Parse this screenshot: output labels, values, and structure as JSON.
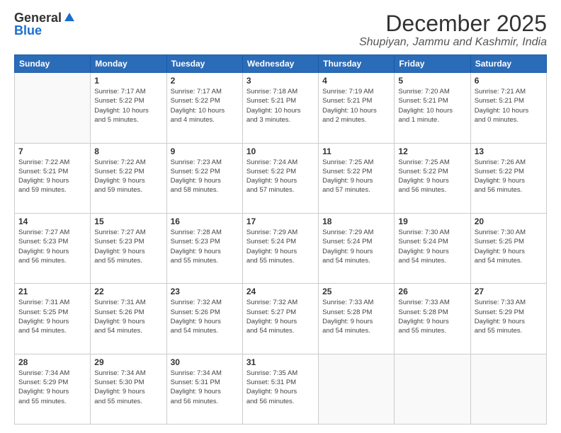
{
  "logo": {
    "general": "General",
    "blue": "Blue"
  },
  "title": "December 2025",
  "location": "Shupiyan, Jammu and Kashmir, India",
  "weekdays": [
    "Sunday",
    "Monday",
    "Tuesday",
    "Wednesday",
    "Thursday",
    "Friday",
    "Saturday"
  ],
  "weeks": [
    [
      {
        "day": "",
        "info": ""
      },
      {
        "day": "1",
        "info": "Sunrise: 7:17 AM\nSunset: 5:22 PM\nDaylight: 10 hours\nand 5 minutes."
      },
      {
        "day": "2",
        "info": "Sunrise: 7:17 AM\nSunset: 5:22 PM\nDaylight: 10 hours\nand 4 minutes."
      },
      {
        "day": "3",
        "info": "Sunrise: 7:18 AM\nSunset: 5:21 PM\nDaylight: 10 hours\nand 3 minutes."
      },
      {
        "day": "4",
        "info": "Sunrise: 7:19 AM\nSunset: 5:21 PM\nDaylight: 10 hours\nand 2 minutes."
      },
      {
        "day": "5",
        "info": "Sunrise: 7:20 AM\nSunset: 5:21 PM\nDaylight: 10 hours\nand 1 minute."
      },
      {
        "day": "6",
        "info": "Sunrise: 7:21 AM\nSunset: 5:21 PM\nDaylight: 10 hours\nand 0 minutes."
      }
    ],
    [
      {
        "day": "7",
        "info": "Sunrise: 7:22 AM\nSunset: 5:21 PM\nDaylight: 9 hours\nand 59 minutes."
      },
      {
        "day": "8",
        "info": "Sunrise: 7:22 AM\nSunset: 5:22 PM\nDaylight: 9 hours\nand 59 minutes."
      },
      {
        "day": "9",
        "info": "Sunrise: 7:23 AM\nSunset: 5:22 PM\nDaylight: 9 hours\nand 58 minutes."
      },
      {
        "day": "10",
        "info": "Sunrise: 7:24 AM\nSunset: 5:22 PM\nDaylight: 9 hours\nand 57 minutes."
      },
      {
        "day": "11",
        "info": "Sunrise: 7:25 AM\nSunset: 5:22 PM\nDaylight: 9 hours\nand 57 minutes."
      },
      {
        "day": "12",
        "info": "Sunrise: 7:25 AM\nSunset: 5:22 PM\nDaylight: 9 hours\nand 56 minutes."
      },
      {
        "day": "13",
        "info": "Sunrise: 7:26 AM\nSunset: 5:22 PM\nDaylight: 9 hours\nand 56 minutes."
      }
    ],
    [
      {
        "day": "14",
        "info": "Sunrise: 7:27 AM\nSunset: 5:23 PM\nDaylight: 9 hours\nand 56 minutes."
      },
      {
        "day": "15",
        "info": "Sunrise: 7:27 AM\nSunset: 5:23 PM\nDaylight: 9 hours\nand 55 minutes."
      },
      {
        "day": "16",
        "info": "Sunrise: 7:28 AM\nSunset: 5:23 PM\nDaylight: 9 hours\nand 55 minutes."
      },
      {
        "day": "17",
        "info": "Sunrise: 7:29 AM\nSunset: 5:24 PM\nDaylight: 9 hours\nand 55 minutes."
      },
      {
        "day": "18",
        "info": "Sunrise: 7:29 AM\nSunset: 5:24 PM\nDaylight: 9 hours\nand 54 minutes."
      },
      {
        "day": "19",
        "info": "Sunrise: 7:30 AM\nSunset: 5:24 PM\nDaylight: 9 hours\nand 54 minutes."
      },
      {
        "day": "20",
        "info": "Sunrise: 7:30 AM\nSunset: 5:25 PM\nDaylight: 9 hours\nand 54 minutes."
      }
    ],
    [
      {
        "day": "21",
        "info": "Sunrise: 7:31 AM\nSunset: 5:25 PM\nDaylight: 9 hours\nand 54 minutes."
      },
      {
        "day": "22",
        "info": "Sunrise: 7:31 AM\nSunset: 5:26 PM\nDaylight: 9 hours\nand 54 minutes."
      },
      {
        "day": "23",
        "info": "Sunrise: 7:32 AM\nSunset: 5:26 PM\nDaylight: 9 hours\nand 54 minutes."
      },
      {
        "day": "24",
        "info": "Sunrise: 7:32 AM\nSunset: 5:27 PM\nDaylight: 9 hours\nand 54 minutes."
      },
      {
        "day": "25",
        "info": "Sunrise: 7:33 AM\nSunset: 5:28 PM\nDaylight: 9 hours\nand 54 minutes."
      },
      {
        "day": "26",
        "info": "Sunrise: 7:33 AM\nSunset: 5:28 PM\nDaylight: 9 hours\nand 55 minutes."
      },
      {
        "day": "27",
        "info": "Sunrise: 7:33 AM\nSunset: 5:29 PM\nDaylight: 9 hours\nand 55 minutes."
      }
    ],
    [
      {
        "day": "28",
        "info": "Sunrise: 7:34 AM\nSunset: 5:29 PM\nDaylight: 9 hours\nand 55 minutes."
      },
      {
        "day": "29",
        "info": "Sunrise: 7:34 AM\nSunset: 5:30 PM\nDaylight: 9 hours\nand 55 minutes."
      },
      {
        "day": "30",
        "info": "Sunrise: 7:34 AM\nSunset: 5:31 PM\nDaylight: 9 hours\nand 56 minutes."
      },
      {
        "day": "31",
        "info": "Sunrise: 7:35 AM\nSunset: 5:31 PM\nDaylight: 9 hours\nand 56 minutes."
      },
      {
        "day": "",
        "info": ""
      },
      {
        "day": "",
        "info": ""
      },
      {
        "day": "",
        "info": ""
      }
    ]
  ]
}
